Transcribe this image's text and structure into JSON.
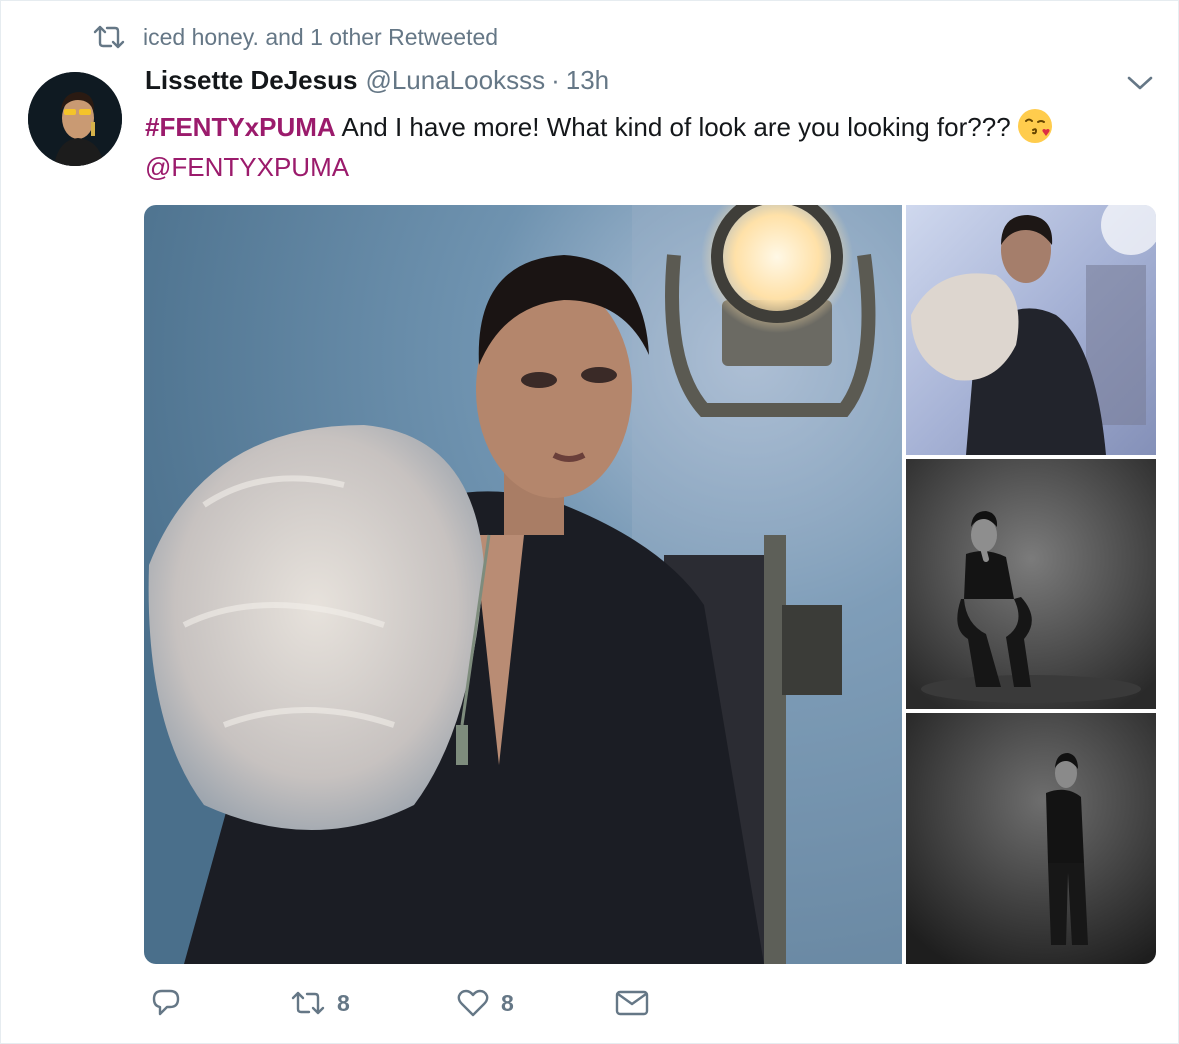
{
  "retweet_context": {
    "icon": "retweet-icon",
    "text": "iced honey. and 1 other Retweeted"
  },
  "author": {
    "display_name": "Lissette DeJesus",
    "handle": "@LunaLooksss",
    "separator": "·",
    "time": "13h"
  },
  "tweet": {
    "hashtag": "#FENTYxPUMA",
    "body": " And I have more! What kind of look are you looking for???",
    "emoji": "kissing-face-emoji",
    "mention": "@FENTYXPUMA"
  },
  "media": {
    "count": 4,
    "items": [
      "photo-main",
      "photo-side-1",
      "photo-side-2",
      "photo-side-3"
    ]
  },
  "actions": {
    "reply": {
      "icon": "reply-icon"
    },
    "retweet": {
      "icon": "retweet-icon",
      "count": "8"
    },
    "like": {
      "icon": "heart-icon",
      "count": "8"
    },
    "message": {
      "icon": "envelope-icon"
    }
  },
  "colors": {
    "accent": "#9b1b6c",
    "muted": "#657786",
    "text": "#14171a"
  }
}
